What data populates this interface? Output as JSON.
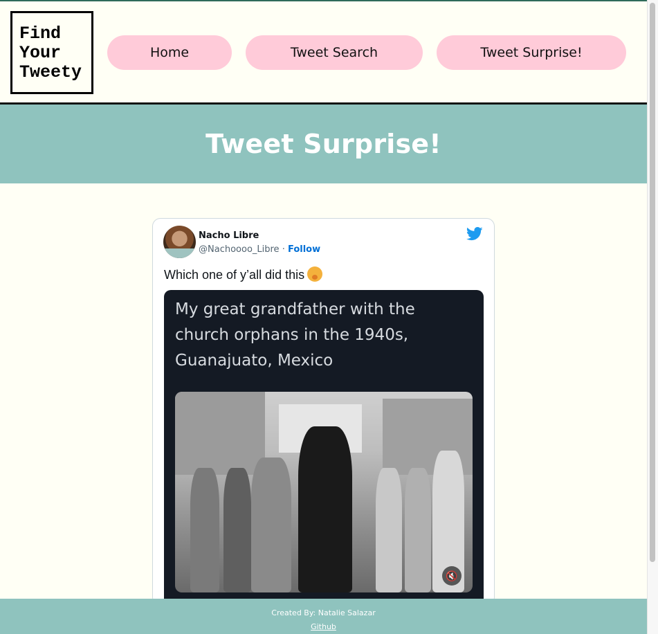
{
  "logo": {
    "line1": "Find",
    "line2": "Your",
    "line3": "Tweety"
  },
  "nav": {
    "home": "Home",
    "search": "Tweet Search",
    "surprise": "Tweet Surprise!"
  },
  "hero": {
    "title": "Tweet Surprise!"
  },
  "tweet": {
    "author_name": "Nacho Libre",
    "handle": "@Nachoooo_Libre",
    "separator": "·",
    "follow": "Follow",
    "text": "Which one of y’all did this",
    "media_caption": "My great grandfather with the church orphans in the 1940s, Guanajuato, Mexico",
    "brand_color": "#1d9bf0"
  },
  "footer": {
    "credit": "Created By: Natalie Salazar",
    "link": "Github"
  },
  "colors": {
    "accent": "#8fc3be",
    "nav_button": "#ffcbd9",
    "background": "#fffff5"
  }
}
